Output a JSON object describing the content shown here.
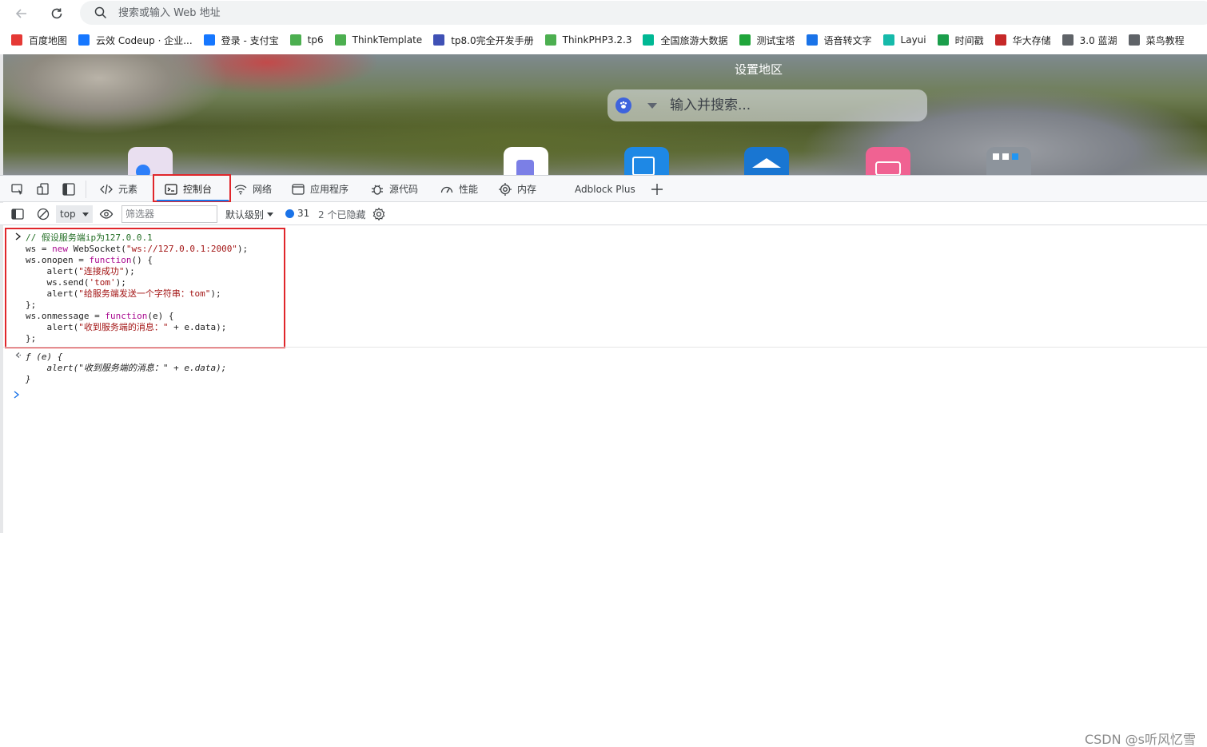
{
  "browser": {
    "address_placeholder": "搜索或输入 Web 地址"
  },
  "bookmarks": [
    {
      "label": "百度地图",
      "icon": "map-pin-icon",
      "color": "#e53935"
    },
    {
      "label": "云效 Codeup · 企业...",
      "icon": "codeup-icon",
      "color": "#1677ff"
    },
    {
      "label": "登录 - 支付宝",
      "icon": "alipay-icon",
      "color": "#1677ff"
    },
    {
      "label": "tp6",
      "icon": "thinkphp-icon",
      "color": "#4caf50"
    },
    {
      "label": "ThinkTemplate",
      "icon": "thinkphp-icon",
      "color": "#4caf50"
    },
    {
      "label": "tp8.0完全开发手册",
      "icon": "kancloud-icon",
      "color": "#3f51b5"
    },
    {
      "label": "ThinkPHP3.2.3",
      "icon": "thinkphp-icon",
      "color": "#4caf50"
    },
    {
      "label": "全国旅游大数据",
      "icon": "play-icon",
      "color": "#00b894"
    },
    {
      "label": "测试宝塔",
      "icon": "shield-icon",
      "color": "#20a53a"
    },
    {
      "label": "语音转文字",
      "icon": "arrow-icon",
      "color": "#1a73e8"
    },
    {
      "label": "Layui",
      "icon": "layui-icon",
      "color": "#16baaa"
    },
    {
      "label": "时间戳",
      "icon": "t-icon",
      "color": "#1b9e4b"
    },
    {
      "label": "华大存储",
      "icon": "jd-icon",
      "color": "#c62828"
    },
    {
      "label": "3.0 蓝湖",
      "icon": "document-icon",
      "color": "#5f6368"
    },
    {
      "label": "菜鸟教程",
      "icon": "document-icon",
      "color": "#5f6368"
    }
  ],
  "newtab": {
    "region_label": "设置地区",
    "search_placeholder": "输入并搜索..."
  },
  "devtools": {
    "tabs": {
      "elements": "元素",
      "console": "控制台",
      "network": "网络",
      "application": "应用程序",
      "sources": "源代码",
      "performance": "性能",
      "memory": "内存",
      "adblock": "Adblock Plus"
    },
    "toolbar": {
      "context": "top",
      "filter_placeholder": "筛选器",
      "levels": "默认级别",
      "message_count": "31",
      "hidden": "2 个已隐藏"
    }
  },
  "console": {
    "input_lines": [
      [
        [
          "cm",
          "// 假设服务端ip为127.0.0.1"
        ]
      ],
      [
        [
          "tx",
          "ws = "
        ],
        [
          "kw",
          "new"
        ],
        [
          "tx",
          " WebSocket("
        ],
        [
          "st",
          "\"ws://127.0.0.1:2000\""
        ],
        [
          "tx",
          ");"
        ]
      ],
      [
        [
          "tx",
          "ws.onopen = "
        ],
        [
          "kw",
          "function"
        ],
        [
          "tx",
          "() {"
        ]
      ],
      [
        [
          "tx",
          "    alert("
        ],
        [
          "st",
          "\"连接成功\""
        ],
        [
          "tx",
          ");"
        ]
      ],
      [
        [
          "tx",
          "    ws.send("
        ],
        [
          "st",
          "'tom'"
        ],
        [
          "tx",
          ");"
        ]
      ],
      [
        [
          "tx",
          "    alert("
        ],
        [
          "st",
          "\"给服务端发送一个字符串：tom\""
        ],
        [
          "tx",
          ");"
        ]
      ],
      [
        [
          "tx",
          "};"
        ]
      ],
      [
        [
          "tx",
          "ws.onmessage = "
        ],
        [
          "kw",
          "function"
        ],
        [
          "tx",
          "(e) {"
        ]
      ],
      [
        [
          "tx",
          "    alert("
        ],
        [
          "st",
          "\"收到服务端的消息：\""
        ],
        [
          "tx",
          " + e.data);"
        ]
      ],
      [
        [
          "tx",
          "};"
        ]
      ]
    ],
    "output_lines": [
      "ƒ (e) {",
      "    alert(\"收到服务端的消息：\" + e.data);",
      "}"
    ]
  },
  "watermark": "CSDN @s听风忆雪"
}
